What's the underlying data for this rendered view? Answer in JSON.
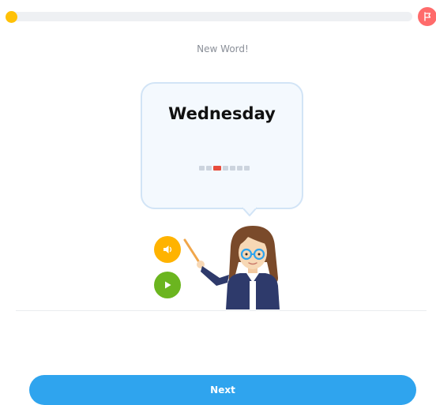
{
  "progress": {
    "value": 0.0
  },
  "flag": {
    "icon": "flag-icon"
  },
  "card": {
    "subtitle": "New Word!",
    "word": "Wednesday",
    "calendar": {
      "days": 7,
      "active_index": 2
    }
  },
  "audio_button": {
    "icon": "speaker-icon"
  },
  "video_button": {
    "icon": "play-icon"
  },
  "illustration": {
    "name": "teacher-illustration"
  },
  "next_button": {
    "label": "Next"
  },
  "colors": {
    "progress": "#ffc107",
    "flag": "#ff6b6b",
    "audio": "#ffb300",
    "video": "#6bb51f",
    "primary": "#2fa4ee"
  }
}
